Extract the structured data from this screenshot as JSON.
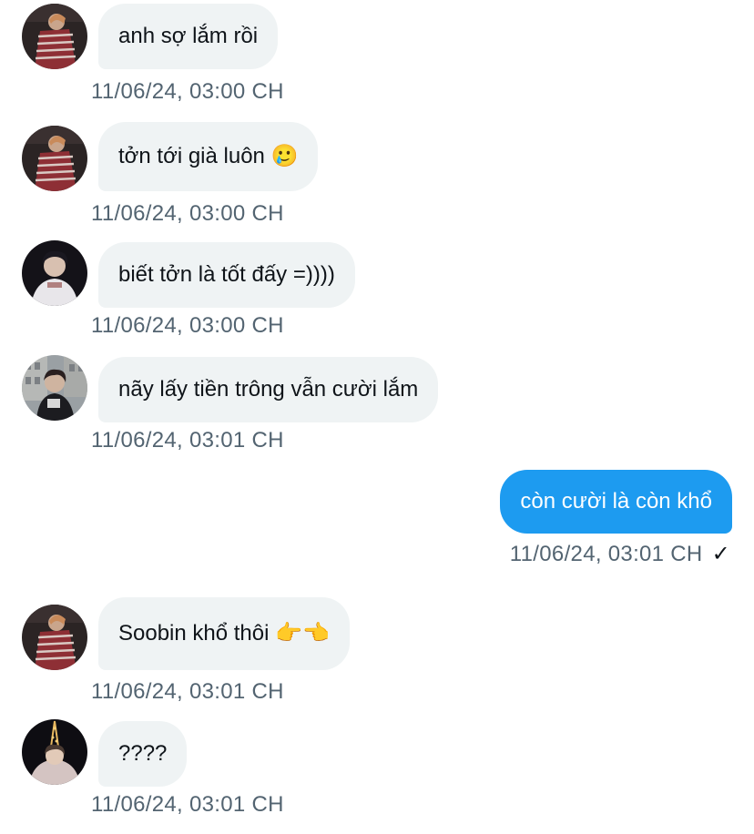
{
  "messages": [
    {
      "text": "anh sợ lắm rồi",
      "time": "11/06/24, 03:00 CH",
      "direction": "in",
      "avatar": "avatar-striped-sweater"
    },
    {
      "text": "tởn tới già luôn 🥲",
      "time": "11/06/24, 03:00 CH",
      "direction": "in",
      "avatar": "avatar-striped-sweater"
    },
    {
      "text": "biết tởn là tốt đấy =))))",
      "time": "11/06/24, 03:00 CH",
      "direction": "in",
      "avatar": "avatar-dark-portrait"
    },
    {
      "text": "nãy lấy tiền trông vẫn cười lắm",
      "time": "11/06/24, 03:01 CH",
      "direction": "in",
      "avatar": "avatar-city-street"
    },
    {
      "text": "còn cười là còn khổ",
      "time": "11/06/24, 03:01 CH",
      "direction": "out",
      "status": "✓"
    },
    {
      "text": "Soobin khổ thôi 👉👈",
      "time": "11/06/24, 03:01 CH",
      "direction": "in",
      "avatar": "avatar-striped-sweater"
    },
    {
      "text": "????",
      "time": "11/06/24, 03:01 CH",
      "direction": "in",
      "avatar": "avatar-eiffel-night"
    }
  ],
  "colors": {
    "incoming_bubble": "#eff3f4",
    "outgoing_bubble": "#1d9bf0",
    "timestamp": "#536471",
    "text": "#0f1419"
  }
}
